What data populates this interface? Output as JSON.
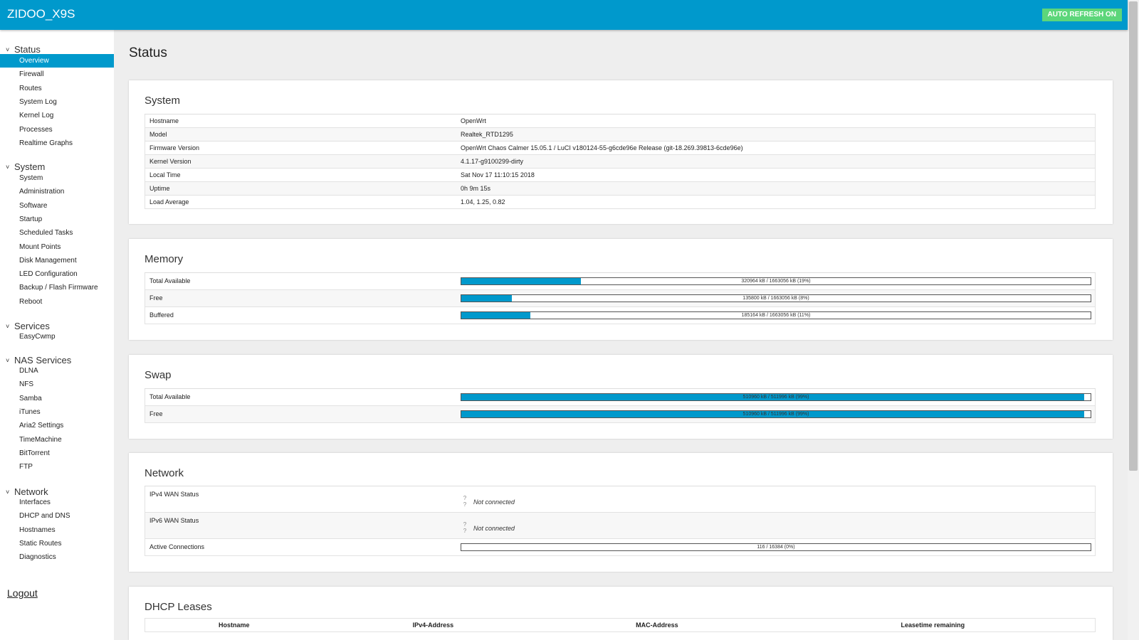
{
  "header": {
    "brand": "ZIDOO_X9S",
    "auto_refresh": "AUTO REFRESH ON"
  },
  "sidebar": {
    "categories": [
      {
        "label": "Status",
        "items": [
          "Overview",
          "Firewall",
          "Routes",
          "System Log",
          "Kernel Log",
          "Processes",
          "Realtime Graphs"
        ]
      },
      {
        "label": "System",
        "items": [
          "System",
          "Administration",
          "Software",
          "Startup",
          "Scheduled Tasks",
          "Mount Points",
          "Disk Management",
          "LED Configuration",
          "Backup / Flash Firmware",
          "Reboot"
        ]
      },
      {
        "label": "Services",
        "items": [
          "EasyCwmp"
        ]
      },
      {
        "label": "NAS Services",
        "items": [
          "DLNA",
          "NFS",
          "Samba",
          "iTunes",
          "Aria2 Settings",
          "TimeMachine",
          "BitTorrent",
          "FTP"
        ]
      },
      {
        "label": "Network",
        "items": [
          "Interfaces",
          "DHCP and DNS",
          "Hostnames",
          "Static Routes",
          "Diagnostics"
        ]
      }
    ],
    "active_item": "Overview",
    "logout": "Logout"
  },
  "page": {
    "title": "Status"
  },
  "system": {
    "title": "System",
    "rows": [
      {
        "label": "Hostname",
        "value": "OpenWrt"
      },
      {
        "label": "Model",
        "value": "Realtek_RTD1295"
      },
      {
        "label": "Firmware Version",
        "value": "OpenWrt Chaos Calmer 15.05.1 / LuCI v180124-55-g6cde96e Release (git-18.269.39813-6cde96e)"
      },
      {
        "label": "Kernel Version",
        "value": "4.1.17-g9100299-dirty"
      },
      {
        "label": "Local Time",
        "value": "Sat Nov 17 11:10:15 2018"
      },
      {
        "label": "Uptime",
        "value": "0h 9m 15s"
      },
      {
        "label": "Load Average",
        "value": "1.04, 1.25, 0.82"
      }
    ]
  },
  "memory": {
    "title": "Memory",
    "rows": [
      {
        "label": "Total Available",
        "text": "320964 kB / 1663056 kB (19%)",
        "fraction": 0.19
      },
      {
        "label": "Free",
        "text": "135800 kB / 1663056 kB (8%)",
        "fraction": 0.08
      },
      {
        "label": "Buffered",
        "text": "185164 kB / 1663056 kB (11%)",
        "fraction": 0.11
      }
    ]
  },
  "swap": {
    "title": "Swap",
    "rows": [
      {
        "label": "Total Available",
        "text": "510960 kB / 511996 kB (99%)",
        "fraction": 0.99
      },
      {
        "label": "Free",
        "text": "510960 kB / 511996 kB (99%)",
        "fraction": 0.99
      }
    ]
  },
  "network": {
    "title": "Network",
    "ipv4_label": "IPv4 WAN Status",
    "ipv4_value": "Not connected",
    "ipv6_label": "IPv6 WAN Status",
    "ipv6_value": "Not connected",
    "wan_icon": "question-icon",
    "conn_label": "Active Connections",
    "conn_text": "116 / 16384 (0%)",
    "conn_fraction": 0.0
  },
  "dhcp": {
    "title": "DHCP Leases",
    "columns": [
      "Hostname",
      "IPv4-Address",
      "MAC-Address",
      "Leasetime remaining"
    ]
  },
  "colors": {
    "accent": "#0099cc",
    "auto_refresh": "#5cd67a"
  }
}
